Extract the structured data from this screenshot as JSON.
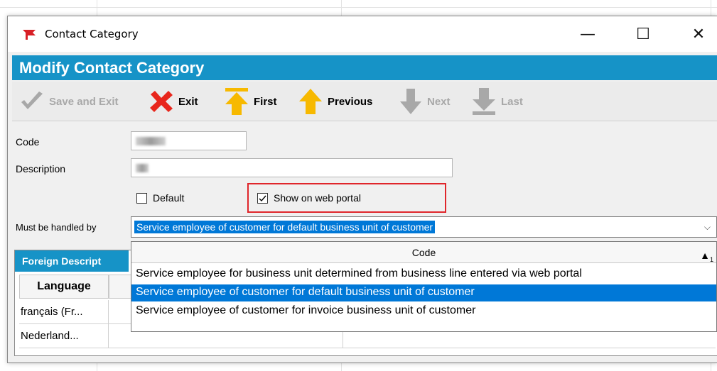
{
  "window": {
    "title": "Contact Category",
    "minimize_glyph": "—",
    "maximize_glyph": "☐",
    "close_glyph": "✕"
  },
  "header": {
    "title": "Modify Contact Category"
  },
  "toolbar": {
    "save_and_exit": "Save and Exit",
    "exit": "Exit",
    "first": "First",
    "previous": "Previous",
    "next": "Next",
    "last": "Last"
  },
  "form": {
    "code_label": "Code",
    "description_label": "Description",
    "default_label": "Default",
    "default_checked": false,
    "show_on_web_portal_label": "Show on web portal",
    "show_on_web_portal_checked": true,
    "must_be_handled_by_label": "Must be handled by",
    "must_be_handled_by_value": "Service employee of customer for default business unit of customer"
  },
  "foreign_descriptions": {
    "panel_title": "Foreign Descript",
    "column_language": "Language",
    "rows": [
      "français (Fr...",
      "Nederland..."
    ]
  },
  "dropdown": {
    "column_header": "Code",
    "sort_indicator": "1",
    "options": [
      "Service employee for business unit determined from business line entered via web portal",
      "Service employee of customer for default business unit of customer",
      "Service employee of customer for invoice business unit of customer"
    ],
    "selected_index": 1
  },
  "colors": {
    "accent_blue": "#1693c7",
    "selection_blue": "#0078d7",
    "highlight_red": "#e0262b",
    "arrow_yellow": "#f7b900",
    "exit_red": "#e8261c"
  }
}
